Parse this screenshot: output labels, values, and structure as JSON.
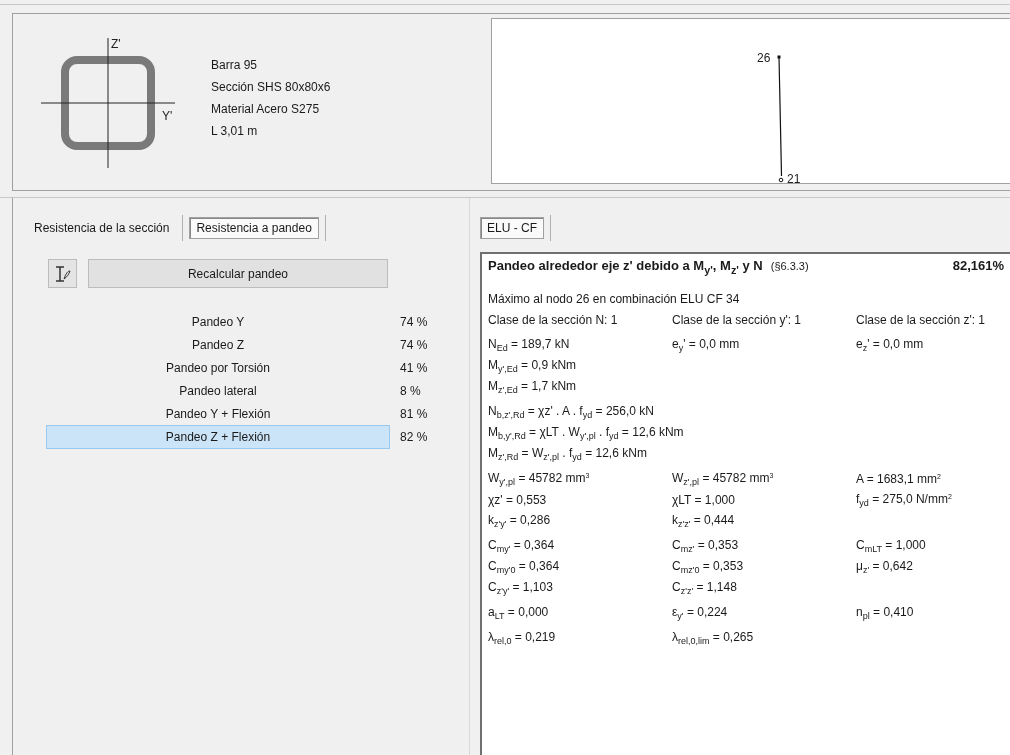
{
  "section": {
    "axis_z": "Z'",
    "axis_y": "Y'",
    "lines": [
      "Barra 95",
      "Sección SHS 80x80x6",
      "Material Acero S275",
      "L 3,01 m"
    ]
  },
  "diagram": {
    "top_node": "26",
    "bottom_node": "21"
  },
  "left_tabs": [
    {
      "label": "Resistencia de la sección",
      "selected": false
    },
    {
      "label": "Resistencia a pandeo",
      "selected": true
    }
  ],
  "recalc_button": "Recalcular pandeo",
  "checks": [
    {
      "name": "Pandeo Y",
      "value": "74 %",
      "selected": false
    },
    {
      "name": "Pandeo Z",
      "value": "74 %",
      "selected": false
    },
    {
      "name": "Pandeo por Torsión",
      "value": "41 %",
      "selected": false
    },
    {
      "name": "Pandeo lateral",
      "value": "8 %",
      "selected": false
    },
    {
      "name": "Pandeo Y + Flexión",
      "value": "81 %",
      "selected": false
    },
    {
      "name": "Pandeo Z + Flexión",
      "value": "82 %",
      "selected": true
    }
  ],
  "right_tabs": [
    {
      "label": "ELU - CF",
      "selected": true
    }
  ],
  "report": {
    "title": "Pandeo alrededor eje z' debido a M$_{y'}$, M$_{z'}$ y N",
    "reference": "(§6.3.3)",
    "ratio": "82,161%",
    "groups": [
      [
        [
          "Máximo al nodo 26 en combinación ELU CF 34"
        ],
        [
          "Clase de la sección N: 1",
          "Clase de la sección y': 1",
          "Clase de la sección z': 1"
        ]
      ],
      [
        [
          "N$_{Ed}$ = 189,7 kN",
          "e$_{y}$' = 0,0 mm",
          "e$_{z}$' = 0,0 mm"
        ],
        [
          "M$_{y',Ed}$ = 0,9 kNm"
        ],
        [
          "M$_{z',Ed}$ = 1,7 kNm"
        ]
      ],
      [
        [
          "N$_{b,z',Rd}$ = χz' . A . f$_{yd}$ = 256,0 kN"
        ],
        [
          "M$_{b,y',Rd}$ = χLT . W$_{y',pl}$ . f$_{yd}$ = 12,6 kNm"
        ],
        [
          "M$_{z',Rd}$ = W$_{z',pl}$ . f$_{yd}$ = 12,6 kNm"
        ]
      ],
      [
        [
          "W$_{y',pl}$ = 45782 mm$^{3}$",
          "W$_{z',pl}$ = 45782 mm$^{3}$",
          "A = 1683,1 mm$^{2}$"
        ],
        [
          "χz' = 0,553",
          "χLT = 1,000",
          "f$_{yd}$ = 275,0 N/mm$^{2}$"
        ],
        [
          "k$_{z'y'}$ = 0,286",
          "k$_{z'z'}$ = 0,444"
        ]
      ],
      [
        [
          "C$_{my'}$ = 0,364",
          "C$_{mz'}$ = 0,353",
          "C$_{mLT}$ = 1,000"
        ],
        [
          "C$_{my'0}$ = 0,364",
          "C$_{mz'0}$ = 0,353",
          "μ$_{z'}$ = 0,642"
        ],
        [
          "C$_{z'y'}$ = 1,103",
          "C$_{z'z'}$ = 1,148"
        ]
      ],
      [
        [
          "a$_{LT}$ = 0,000",
          "ε$_{y'}$ = 0,224",
          "n$_{pl}$ = 0,410"
        ]
      ],
      [
        [
          "λ$_{rel,0}$ = 0,219",
          "λ$_{rel,0,lim}$ = 0,265"
        ]
      ]
    ]
  }
}
